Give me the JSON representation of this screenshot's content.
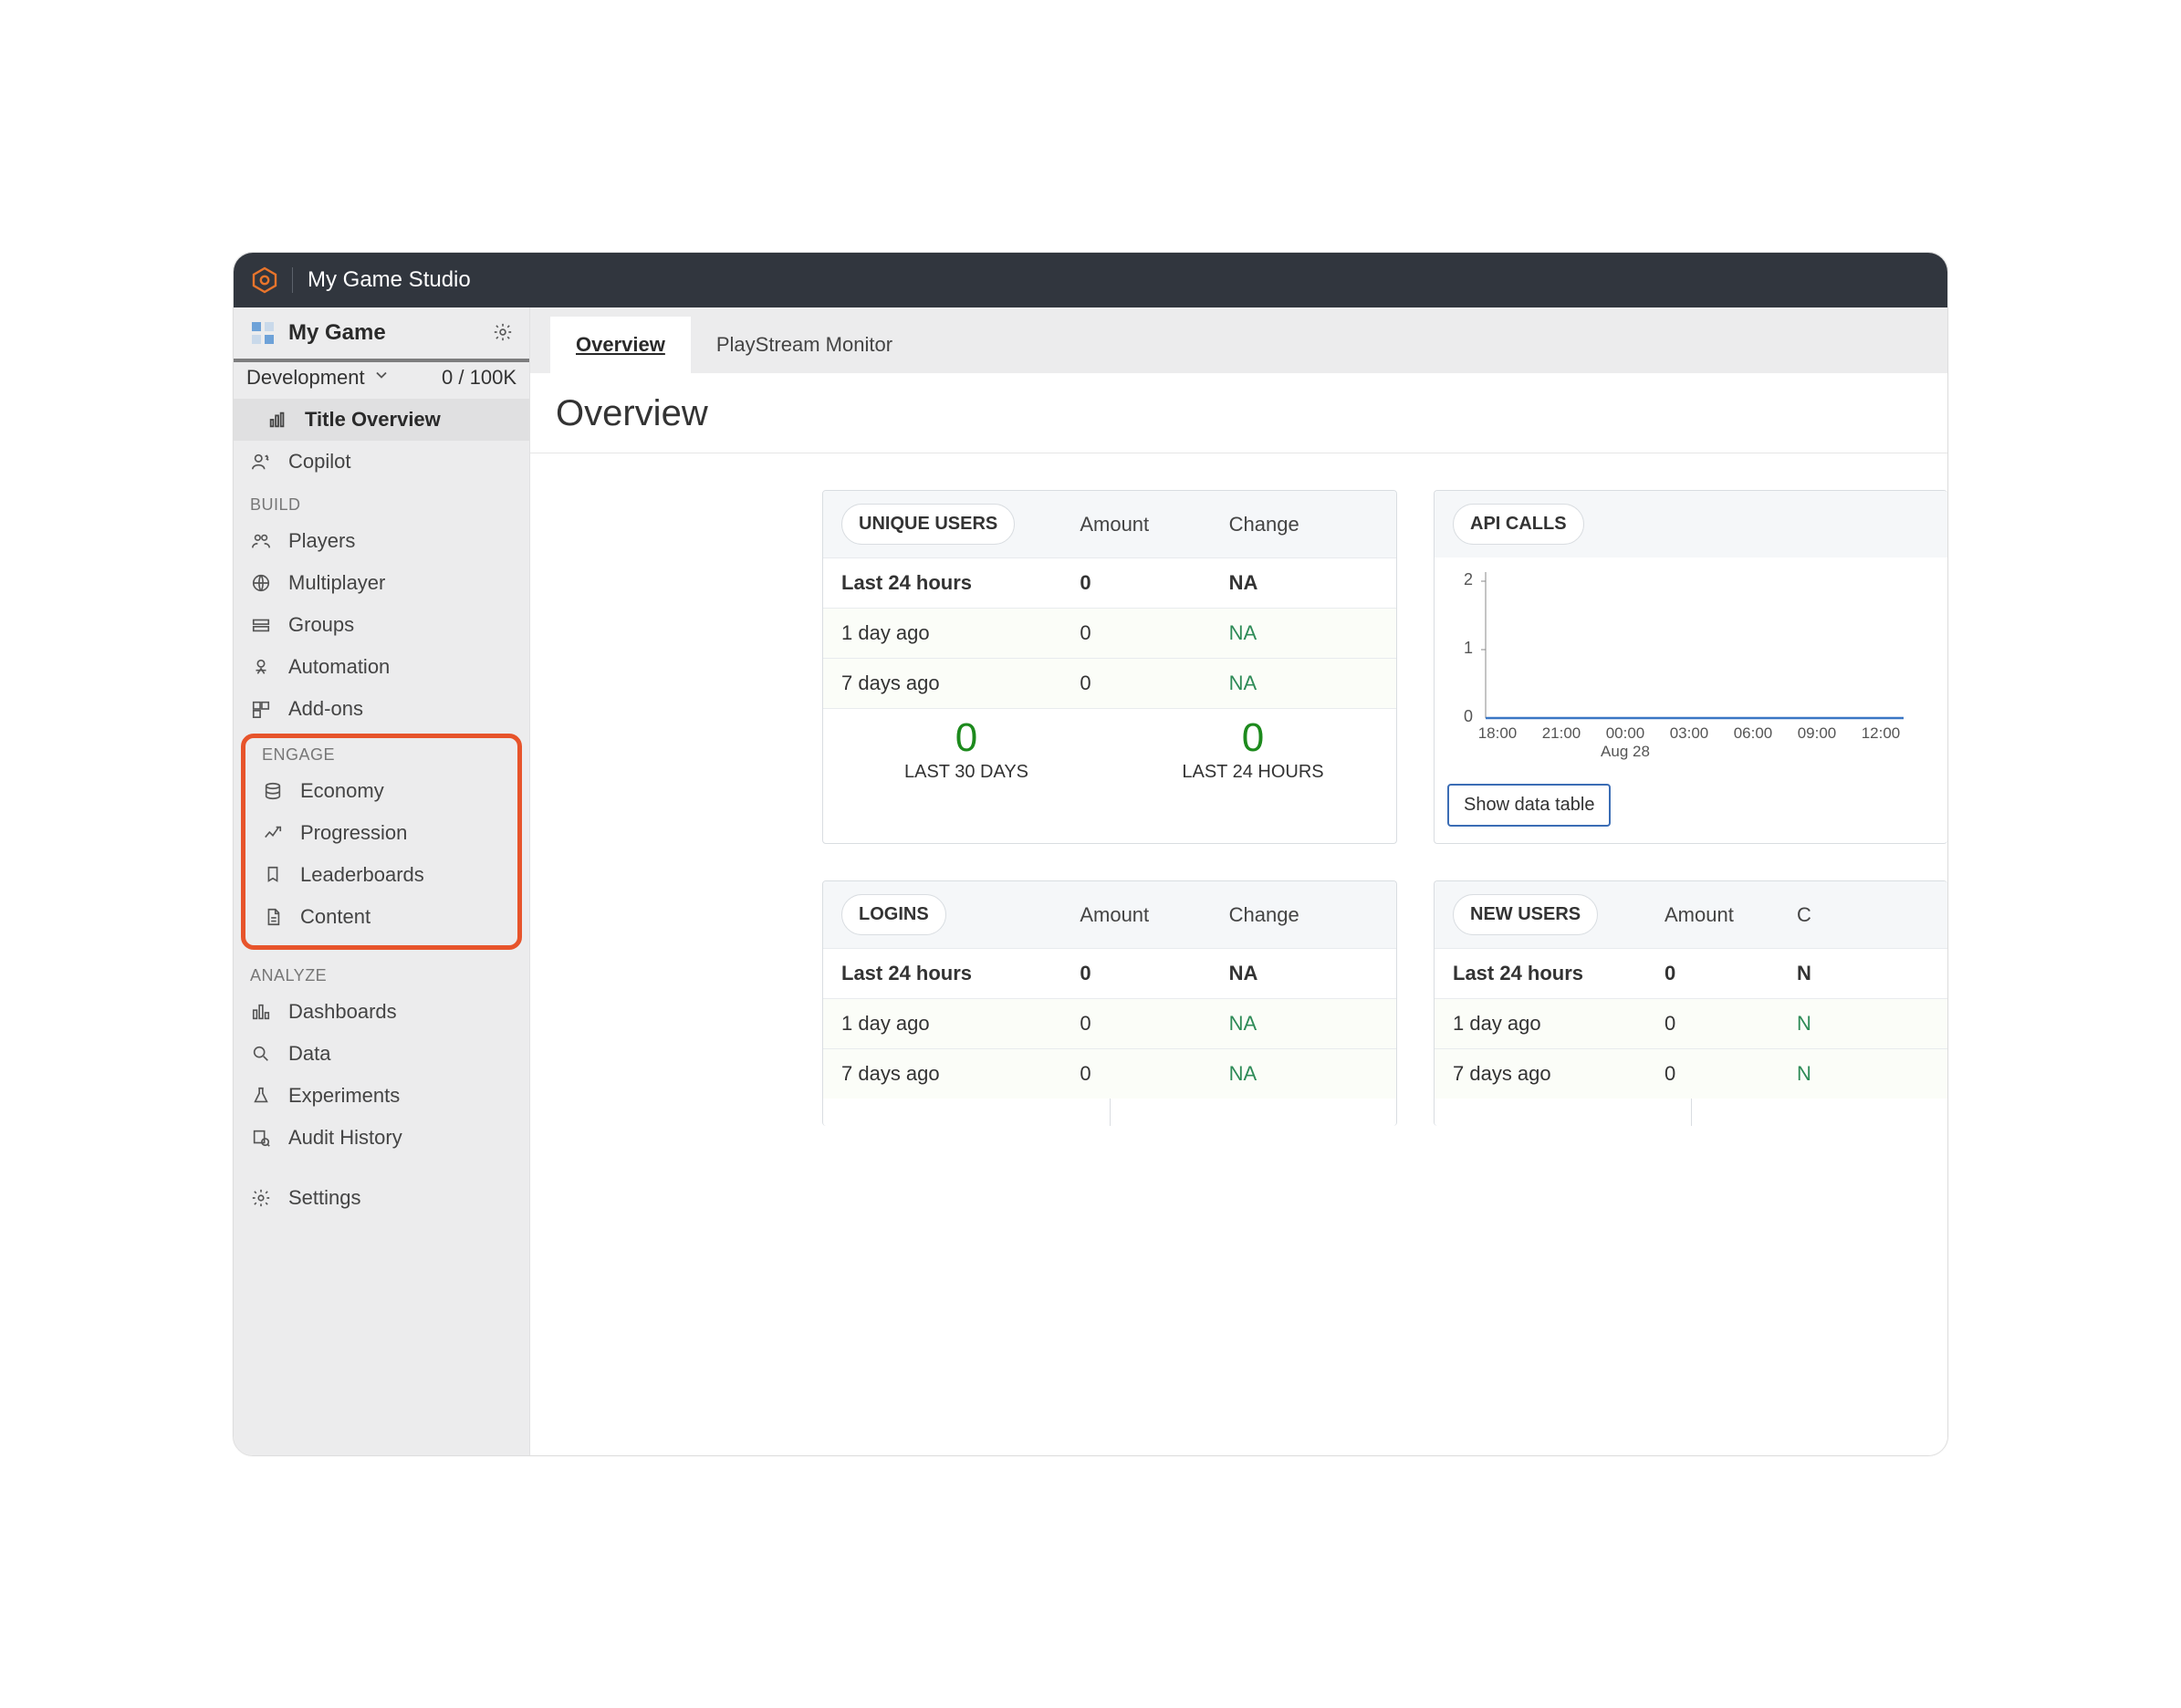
{
  "topbar": {
    "studio": "My Game Studio"
  },
  "sidebar": {
    "game_name": "My Game",
    "env_name": "Development",
    "env_count": "0 / 100K",
    "nav": {
      "title_overview": "Title Overview",
      "copilot": "Copilot"
    },
    "build": {
      "label": "BUILD",
      "players": "Players",
      "multiplayer": "Multiplayer",
      "groups": "Groups",
      "automation": "Automation",
      "addons": "Add-ons"
    },
    "engage": {
      "label": "ENGAGE",
      "economy": "Economy",
      "progression": "Progression",
      "leaderboards": "Leaderboards",
      "content": "Content"
    },
    "analyze": {
      "label": "ANALYZE",
      "dashboards": "Dashboards",
      "data": "Data",
      "experiments": "Experiments",
      "audit": "Audit History"
    },
    "settings": "Settings"
  },
  "tabs": {
    "overview": "Overview",
    "playstream": "PlayStream Monitor"
  },
  "page": {
    "title": "Overview"
  },
  "cards": {
    "unique": {
      "pill": "UNIQUE USERS",
      "amount": "Amount",
      "change": "Change",
      "rows": [
        {
          "label": "Last 24 hours",
          "amount": "0",
          "change": "NA"
        },
        {
          "label": "1 day ago",
          "amount": "0",
          "change": "NA"
        },
        {
          "label": "7 days ago",
          "amount": "0",
          "change": "NA"
        }
      ],
      "summary": {
        "left_big": "0",
        "left_cap": "LAST 30 DAYS",
        "right_big": "0",
        "right_cap": "LAST 24 HOURS"
      }
    },
    "api": {
      "pill": "API CALLS",
      "button": "Show data table",
      "ticks": [
        "18:00",
        "21:00",
        "00:00",
        "03:00",
        "06:00",
        "09:00",
        "12:00"
      ],
      "sub": "Aug 28",
      "yticks": [
        "2",
        "1",
        "0"
      ]
    },
    "logins": {
      "pill": "LOGINS",
      "amount": "Amount",
      "change": "Change",
      "rows": [
        {
          "label": "Last 24 hours",
          "amount": "0",
          "change": "NA"
        },
        {
          "label": "1 day ago",
          "amount": "0",
          "change": "NA"
        },
        {
          "label": "7 days ago",
          "amount": "0",
          "change": "NA"
        }
      ]
    },
    "newusers": {
      "pill": "NEW USERS",
      "amount": "Amount",
      "change": "C",
      "rows": [
        {
          "label": "Last 24 hours",
          "amount": "0",
          "change": "N"
        },
        {
          "label": "1 day ago",
          "amount": "0",
          "change": "N"
        },
        {
          "label": "7 days ago",
          "amount": "0",
          "change": "N"
        }
      ]
    }
  },
  "chart_data": {
    "type": "line",
    "title": "API CALLS",
    "xlabel": "",
    "ylabel": "",
    "ylim": [
      0,
      2
    ],
    "x": [
      "18:00",
      "21:00",
      "00:00",
      "03:00",
      "06:00",
      "09:00",
      "12:00"
    ],
    "x_sub": "Aug 28",
    "values": [
      0,
      0,
      0,
      0,
      0,
      0,
      0
    ]
  }
}
